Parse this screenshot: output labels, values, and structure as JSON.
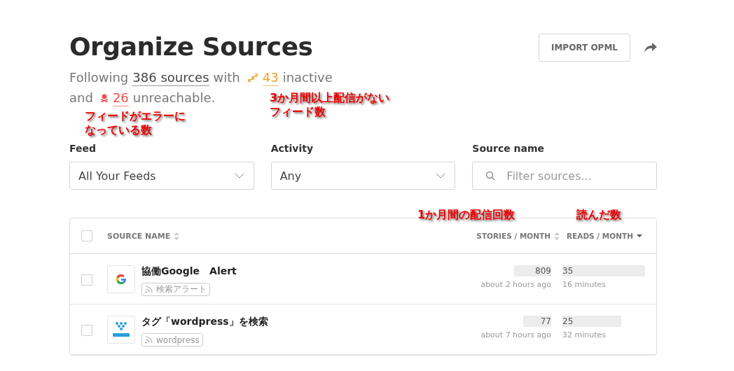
{
  "header": {
    "title": "Organize Sources",
    "import_button": "IMPORT OPML"
  },
  "summary": {
    "prefix": "Following",
    "sources_link": "386 sources",
    "with": "with",
    "inactive_count": "43",
    "inactive_label": "inactive",
    "and": "and",
    "unreachable_count": "26",
    "unreachable_label": "unreachable."
  },
  "annotations": [
    {
      "text": "フィードがエラーになっている数",
      "kind": "unreachable"
    },
    {
      "text": "3か月間以上配信がないフィード数",
      "kind": "inactive"
    },
    {
      "text": "1か月間の配信回数",
      "kind": "stories"
    },
    {
      "text": "読んだ数",
      "kind": "reads"
    }
  ],
  "filters": [
    {
      "label": "Feed",
      "kind": "select",
      "value": "All Your Feeds"
    },
    {
      "label": "Activity",
      "kind": "select",
      "value": "Any"
    },
    {
      "label": "Source name",
      "kind": "search",
      "placeholder": "Filter sources..."
    }
  ],
  "table": {
    "select_all_checked": false,
    "columns": [
      {
        "label": "SOURCE NAME",
        "sorted": false
      },
      {
        "label": "STORIES / MONTH",
        "sorted": false
      },
      {
        "label": "READS / MONTH",
        "sorted": true
      }
    ],
    "rows": [
      {
        "checked": false,
        "name": "協働Google　Alert",
        "tag": "検索アラート",
        "stories": "809",
        "stories_time": "about 2 hours ago",
        "reads": "35",
        "reads_time": "16 minutes"
      },
      {
        "checked": false,
        "name": "タグ「wordpress」を検索",
        "tag": "wordpress",
        "stories": "77",
        "stories_time": "about 7 hours ago",
        "reads": "25",
        "reads_time": "32 minutes"
      }
    ]
  }
}
